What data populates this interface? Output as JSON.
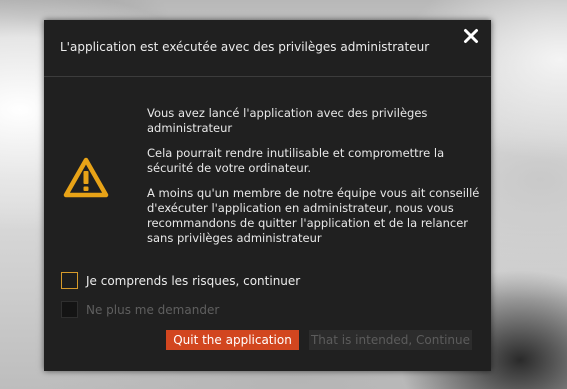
{
  "dialog": {
    "title": "L'application est exécutée avec des privilèges administrateur",
    "close_icon": "close-icon",
    "warning_icon": "warning-triangle-icon",
    "paragraphs": [
      "Vous avez lancé l'application avec des privilèges administrateur",
      "Cela pourrait rendre inutilisable et compromettre la sécurité de votre ordinateur.",
      "A moins qu'un membre de notre équipe vous ait conseillé d'exécuter l'application en administrateur, nous vous recommandons de quitter l'application et de la relancer sans privilèges administrateur"
    ],
    "checkboxes": [
      {
        "label": "Je comprends les risques, continuer",
        "checked": false
      },
      {
        "label": "Ne plus me demander",
        "checked": false,
        "disabled": true
      }
    ],
    "buttons": {
      "quit": "Quit the application",
      "continue": "That is intended, Continue"
    },
    "colors": {
      "background": "#202020",
      "accent": "#d2461f",
      "warning": "#e8a317",
      "checkbox_border": "#d69a2a"
    }
  }
}
